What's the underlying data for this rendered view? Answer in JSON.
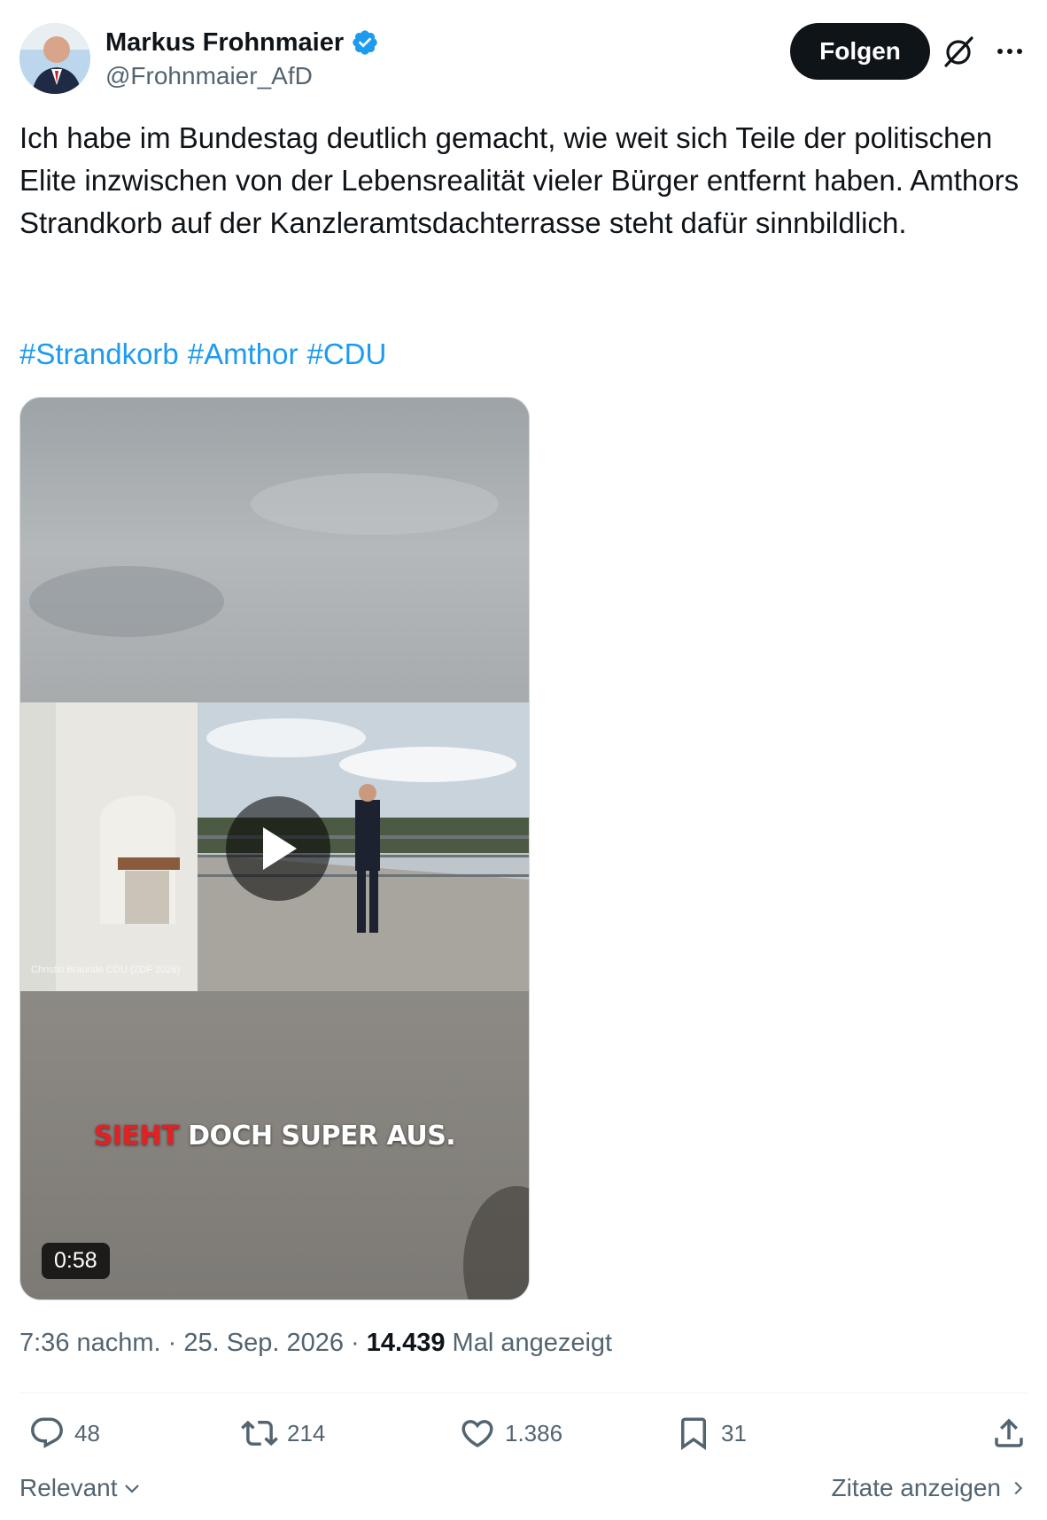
{
  "author": {
    "name": "Markus Frohnmaier",
    "handle": "@Frohnmaier_AfD",
    "verified": true,
    "verified_color": "#1d9bf0"
  },
  "follow_label": "Folgen",
  "tweet": {
    "text": "Ich habe im Bundestag deutlich gemacht, wie weit sich Teile der politischen Elite inzwischen von der Lebensrealität vieler Bürger entfernt haben. Amthors Strandkorb auf der Kanzleramtsdachterrasse steht dafür sinnbildlich.",
    "hashtags": [
      "#Strandkorb",
      "#Amthor",
      "#CDU"
    ]
  },
  "video": {
    "caption_red": "SIEHT",
    "caption_white": "DOCH SUPER AUS.",
    "watermark": "Christin Braunde CDU (ZDF 2026)",
    "duration": "0:58"
  },
  "meta": {
    "time": "7:36 nachm.",
    "date": "25. Sep. 2026",
    "views": "14.439",
    "views_label": "Mal angezeigt"
  },
  "actions": {
    "replies": "48",
    "reposts": "214",
    "likes": "1.386",
    "bookmarks": "31"
  },
  "footer": {
    "sort_label": "Relevant",
    "quotes_label": "Zitate anzeigen"
  },
  "colors": {
    "link": "#1d9bf0",
    "text": "#0f1419",
    "secondary": "#536471",
    "caption_red": "#e32124"
  }
}
